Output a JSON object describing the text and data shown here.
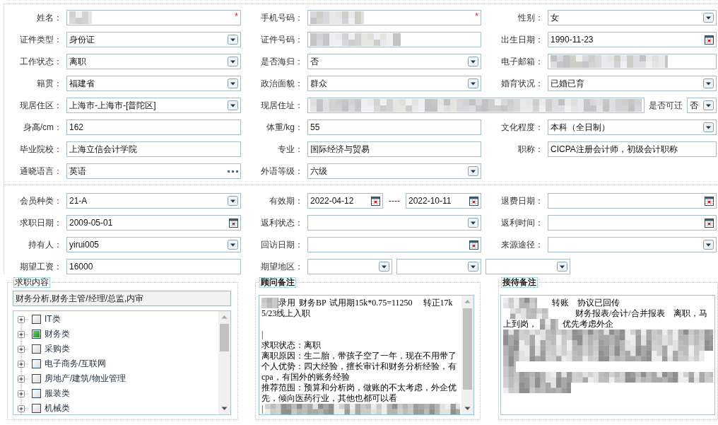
{
  "form_sections": [
    {
      "rows": [
        [
          {
            "label": "姓名：",
            "controls": [
              {
                "kind": "text",
                "masked": true,
                "required_mark": "*"
              }
            ]
          },
          {
            "label": "手机号码：",
            "controls": [
              {
                "kind": "text",
                "masked": true,
                "required_mark": "*"
              }
            ]
          },
          {
            "label": "性别：",
            "controls": [
              {
                "kind": "select",
                "value": "女"
              }
            ]
          }
        ],
        [
          {
            "label": "证件类型：",
            "controls": [
              {
                "kind": "select",
                "value": "身份证"
              }
            ]
          },
          {
            "label": "证件号码：",
            "controls": [
              {
                "kind": "text",
                "masked": true
              }
            ]
          },
          {
            "label": "出生日期：",
            "controls": [
              {
                "kind": "date",
                "value": "1990-11-23"
              }
            ]
          }
        ],
        [
          {
            "label": "工作状态：",
            "controls": [
              {
                "kind": "select",
                "value": "离职"
              }
            ]
          },
          {
            "label": "是否海归：",
            "controls": [
              {
                "kind": "select",
                "value": "否"
              }
            ]
          },
          {
            "label": "电子邮箱：",
            "controls": [
              {
                "kind": "text",
                "masked": true
              }
            ]
          }
        ],
        [
          {
            "label": "籍贯：",
            "controls": [
              {
                "kind": "select",
                "value": "福建省"
              }
            ]
          },
          {
            "label": "政治面貌：",
            "controls": [
              {
                "kind": "select",
                "value": "群众"
              }
            ]
          },
          {
            "label": "婚育状况：",
            "controls": [
              {
                "kind": "select",
                "value": "已婚已育"
              }
            ]
          }
        ],
        [
          {
            "label": "现居住区：",
            "controls": [
              {
                "kind": "select",
                "value": "上海市-上海市-[普陀区]"
              }
            ]
          },
          {
            "label": "现居住址：",
            "controls": [
              {
                "kind": "text",
                "masked": true
              },
              {
                "kind": "label",
                "text": "是否可迁"
              },
              {
                "kind": "select",
                "value": "否"
              }
            ]
          }
        ],
        [
          {
            "label": "身高/cm：",
            "controls": [
              {
                "kind": "text",
                "value": "162"
              }
            ]
          },
          {
            "label": "体重/kg：",
            "controls": [
              {
                "kind": "text",
                "value": "55"
              }
            ]
          },
          {
            "label": "文化程度：",
            "controls": [
              {
                "kind": "select",
                "value": "本科（全日制）"
              }
            ]
          }
        ],
        [
          {
            "label": "毕业院校：",
            "controls": [
              {
                "kind": "text",
                "value": "上海立信会计学院"
              }
            ]
          },
          {
            "label": "专业：",
            "controls": [
              {
                "kind": "text",
                "value": "国际经济与贸易"
              }
            ]
          },
          {
            "label": "职称：",
            "controls": [
              {
                "kind": "text",
                "value": "CICPA注册会计师，初级会计职称"
              }
            ]
          }
        ],
        [
          {
            "label": "通晓语言：",
            "controls": [
              {
                "kind": "lookup",
                "value": "英语"
              }
            ]
          },
          {
            "label": "外语等级：",
            "controls": [
              {
                "kind": "select",
                "value": "六级"
              }
            ]
          }
        ]
      ]
    },
    {
      "rows": [
        [
          {
            "label": "会员种类：",
            "controls": [
              {
                "kind": "select",
                "value": "21-A"
              }
            ]
          },
          {
            "label": "有效期：",
            "controls": [
              {
                "kind": "date",
                "value": "2022-04-12"
              },
              {
                "kind": "separator",
                "text": "----"
              },
              {
                "kind": "date",
                "value": "2022-10-11"
              }
            ]
          },
          {
            "label": "退费日期：",
            "controls": [
              {
                "kind": "date"
              }
            ]
          }
        ],
        [
          {
            "label": "求职日期：",
            "controls": [
              {
                "kind": "date",
                "value": "2009-05-01"
              }
            ]
          },
          {
            "label": "返利状态：",
            "controls": [
              {
                "kind": "select"
              }
            ]
          },
          {
            "label": "返利时间：",
            "controls": [
              {
                "kind": "date"
              }
            ]
          }
        ],
        [
          {
            "label": "持有人：",
            "controls": [
              {
                "kind": "select",
                "value": "yirui005"
              }
            ]
          },
          {
            "label": "回访日期：",
            "controls": [
              {
                "kind": "date"
              }
            ]
          },
          {
            "label": "来源途径：",
            "controls": [
              {
                "kind": "select"
              }
            ]
          }
        ],
        [
          {
            "label": "期望工资：",
            "controls": [
              {
                "kind": "text",
                "value": "16000"
              }
            ]
          },
          {
            "label": "期望地区：",
            "controls": [
              {
                "kind": "select"
              },
              {
                "kind": "select"
              },
              {
                "kind": "select"
              }
            ]
          }
        ]
      ]
    }
  ],
  "job_intent": {
    "legend": "求职内容",
    "summary": "财务分析,财务主管/经理/总监,内审",
    "categories": [
      {
        "label": "IT类",
        "expanded": false,
        "checked": false
      },
      {
        "label": "财务类",
        "expanded": false,
        "checked": true
      },
      {
        "label": "采购类",
        "expanded": false,
        "checked": false
      },
      {
        "label": "电子商务/互联网",
        "expanded": false,
        "checked": false
      },
      {
        "label": "房地产/建筑/物业管理",
        "expanded": false,
        "checked": false
      },
      {
        "label": "服装类",
        "expanded": false,
        "checked": false
      },
      {
        "label": "机械类",
        "expanded": false,
        "checked": false
      }
    ]
  },
  "consultant_notes": {
    "legend": "顾问备注",
    "lines": [
      {
        "kind": "content",
        "segments": [
          {
            "kind": "masked"
          },
          {
            "kind": "text",
            "text": "录用 财务BP 试用期15k*0.75=11250   转正17k"
          }
        ]
      },
      {
        "kind": "content",
        "segments": [
          {
            "kind": "text",
            "text": "5/23线上入职"
          }
        ]
      },
      {
        "kind": "blank"
      },
      {
        "kind": "content",
        "segments": [
          {
            "kind": "text",
            "text": "|"
          }
        ]
      },
      {
        "kind": "content",
        "segments": [
          {
            "kind": "text",
            "text": "求职状态：离职"
          }
        ]
      },
      {
        "kind": "content",
        "segments": [
          {
            "kind": "text",
            "text": "离职原因：生二胎，带孩子空了一年，现在不用带了"
          }
        ]
      },
      {
        "kind": "content",
        "segments": [
          {
            "kind": "text",
            "text": "个人优势：四大经验，擅长审计和财务分析经验，有"
          }
        ]
      },
      {
        "kind": "content",
        "segments": [
          {
            "kind": "text",
            "text": "cpa，有国外的账务经验"
          }
        ]
      },
      {
        "kind": "content",
        "segments": [
          {
            "kind": "text",
            "text": "推荐范围：预算和分析岗，做账的不太考虑，外企优"
          }
        ]
      },
      {
        "kind": "content",
        "segments": [
          {
            "kind": "text",
            "text": "先，倾向医药行业，其他也都可以看"
          }
        ]
      },
      {
        "kind": "content",
        "segments": [
          {
            "kind": "text",
            "text": "|"
          },
          {
            "kind": "masked"
          }
        ]
      }
    ]
  },
  "reception_notes": {
    "legend": "接待备注",
    "lines": [
      {
        "kind": "content",
        "segments": [
          {
            "kind": "masked"
          },
          {
            "kind": "text",
            "text": "转账　协议已回传"
          }
        ]
      },
      {
        "kind": "content",
        "segments": [
          {
            "kind": "masked"
          },
          {
            "kind": "text",
            "text": "财务报表/会计/合并报表　离职，马"
          }
        ]
      },
      {
        "kind": "content",
        "segments": [
          {
            "kind": "text",
            "text": "上到岗，"
          },
          {
            "kind": "masked"
          },
          {
            "kind": "text",
            "text": "优先考虑外企"
          }
        ]
      },
      {
        "kind": "content",
        "segments": [
          {
            "kind": "masked"
          }
        ]
      },
      {
        "kind": "content",
        "segments": [
          {
            "kind": "masked"
          }
        ]
      },
      {
        "kind": "content",
        "segments": [
          {
            "kind": "masked"
          }
        ]
      },
      {
        "kind": "content",
        "segments": [
          {
            "kind": "masked"
          }
        ]
      },
      {
        "kind": "content",
        "segments": [
          {
            "kind": "masked"
          }
        ]
      },
      {
        "kind": "content",
        "segments": [
          {
            "kind": "masked"
          }
        ]
      }
    ]
  }
}
